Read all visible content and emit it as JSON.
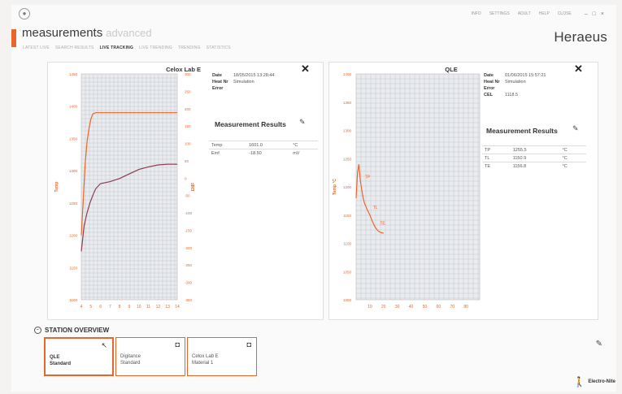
{
  "app": {
    "title": "measurements",
    "subtitle": "advanced",
    "brand": "Heraeus",
    "top_menu": [
      "INFO",
      "SETTINGS",
      "ADULT",
      "HELP",
      "CLOSE"
    ],
    "window_controls": [
      "–",
      "□",
      "×"
    ]
  },
  "nav": {
    "tabs": [
      "LATEST LIVE",
      "SEARCH RESULTS",
      "LIVE TRACKING",
      "LIVE TRENDING",
      "TRENDING",
      "STATISTICS"
    ],
    "active_index": 2
  },
  "left_panel": {
    "chart_title": "Celox Lab E",
    "info": [
      {
        "key": "Date",
        "value": "18/05/2015 13:28:44"
      },
      {
        "key": "Heat Nr",
        "value": "Simulation"
      },
      {
        "key": "Error",
        "value": ""
      }
    ],
    "results_title": "Measurement Results",
    "results": [
      [
        "Temp",
        "1601.0",
        "°C"
      ],
      [
        "Emf",
        "-18.50",
        "mV"
      ]
    ]
  },
  "right_panel": {
    "chart_title": "QLE",
    "info": [
      {
        "key": "Date",
        "value": "01/06/2015 15:57:21"
      },
      {
        "key": "Heat Nr",
        "value": "Simulation"
      },
      {
        "key": "Error",
        "value": ""
      },
      {
        "key": "CEL",
        "value": "1118.5"
      }
    ],
    "results_title": "Measurement Results",
    "results": [
      [
        "TP",
        "1255.5",
        "°C"
      ],
      [
        "TL",
        "1150.9",
        "°C"
      ],
      [
        "TE",
        "1156.8",
        "°C"
      ]
    ]
  },
  "station": {
    "header": "STATION OVERVIEW",
    "cards": [
      {
        "line1": "QLE",
        "line2": "Standard",
        "selected": true
      },
      {
        "line1": "Digitance",
        "line2": "Standard",
        "selected": false
      },
      {
        "line1": "Celox Lab E",
        "line2": "Material 1",
        "selected": false
      }
    ]
  },
  "footer": {
    "logo": "Electro-Nite"
  },
  "colors": {
    "accent": "#e8662c",
    "dark_series": "#8a3e4e"
  },
  "chart_data": [
    {
      "type": "line",
      "title": "Celox Lab E",
      "x_ticks": [
        4,
        5,
        6,
        7,
        8,
        9,
        10,
        11,
        12,
        13,
        14
      ],
      "xlim": [
        4,
        14
      ],
      "y_left_label": "Temp",
      "y_left_ticks": [
        1100,
        1150,
        1200,
        1250,
        1300,
        1350,
        1400,
        1450
      ],
      "ylim_left": [
        1100,
        1450
      ],
      "y_right_label": "EMF",
      "y_right_ticks": [
        -350,
        -300,
        -250,
        -200,
        -150,
        -100,
        -50,
        0,
        50,
        100,
        150,
        200,
        250,
        300
      ],
      "ylim_right": [
        -350,
        300
      ],
      "series": [
        {
          "axis": "left",
          "color": "#e8662c",
          "x": [
            4.0,
            4.2,
            4.4,
            4.6,
            4.8,
            5.0,
            5.2,
            5.5,
            6.0,
            7.0,
            9.0,
            11.0,
            13.0,
            14.0
          ],
          "y": [
            1200,
            1255,
            1310,
            1345,
            1365,
            1380,
            1388,
            1390,
            1390,
            1390,
            1390,
            1390,
            1390,
            1390
          ]
        },
        {
          "axis": "left",
          "color": "#8a3e4e",
          "x": [
            4.0,
            4.3,
            4.6,
            4.9,
            5.2,
            5.5,
            6.0,
            7.0,
            8.0,
            9.0,
            10.0,
            11.0,
            12.0,
            13.0,
            14.0
          ],
          "y": [
            1175,
            1215,
            1235,
            1250,
            1262,
            1272,
            1280,
            1283,
            1288,
            1295,
            1302,
            1306,
            1309,
            1310,
            1310
          ]
        }
      ]
    },
    {
      "type": "line",
      "title": "QLE",
      "x_ticks": [
        10,
        20,
        30,
        40,
        50,
        60,
        70,
        80
      ],
      "xlim": [
        0,
        90
      ],
      "ylabel": "Temp °C",
      "y_ticks": [
        1000,
        1050,
        1100,
        1150,
        1200,
        1250,
        1300,
        1350,
        1400
      ],
      "ylim": [
        1000,
        1400
      ],
      "annotations": [
        "TP",
        "TL",
        "TE"
      ],
      "series": [
        {
          "color": "#e8662c",
          "x": [
            0,
            1,
            2,
            3,
            4,
            5,
            6,
            8,
            10,
            12,
            14,
            16,
            18,
            20
          ],
          "y": [
            1180,
            1225,
            1240,
            1212,
            1196,
            1182,
            1172,
            1160,
            1150,
            1138,
            1128,
            1122,
            1119,
            1118
          ]
        }
      ]
    }
  ]
}
